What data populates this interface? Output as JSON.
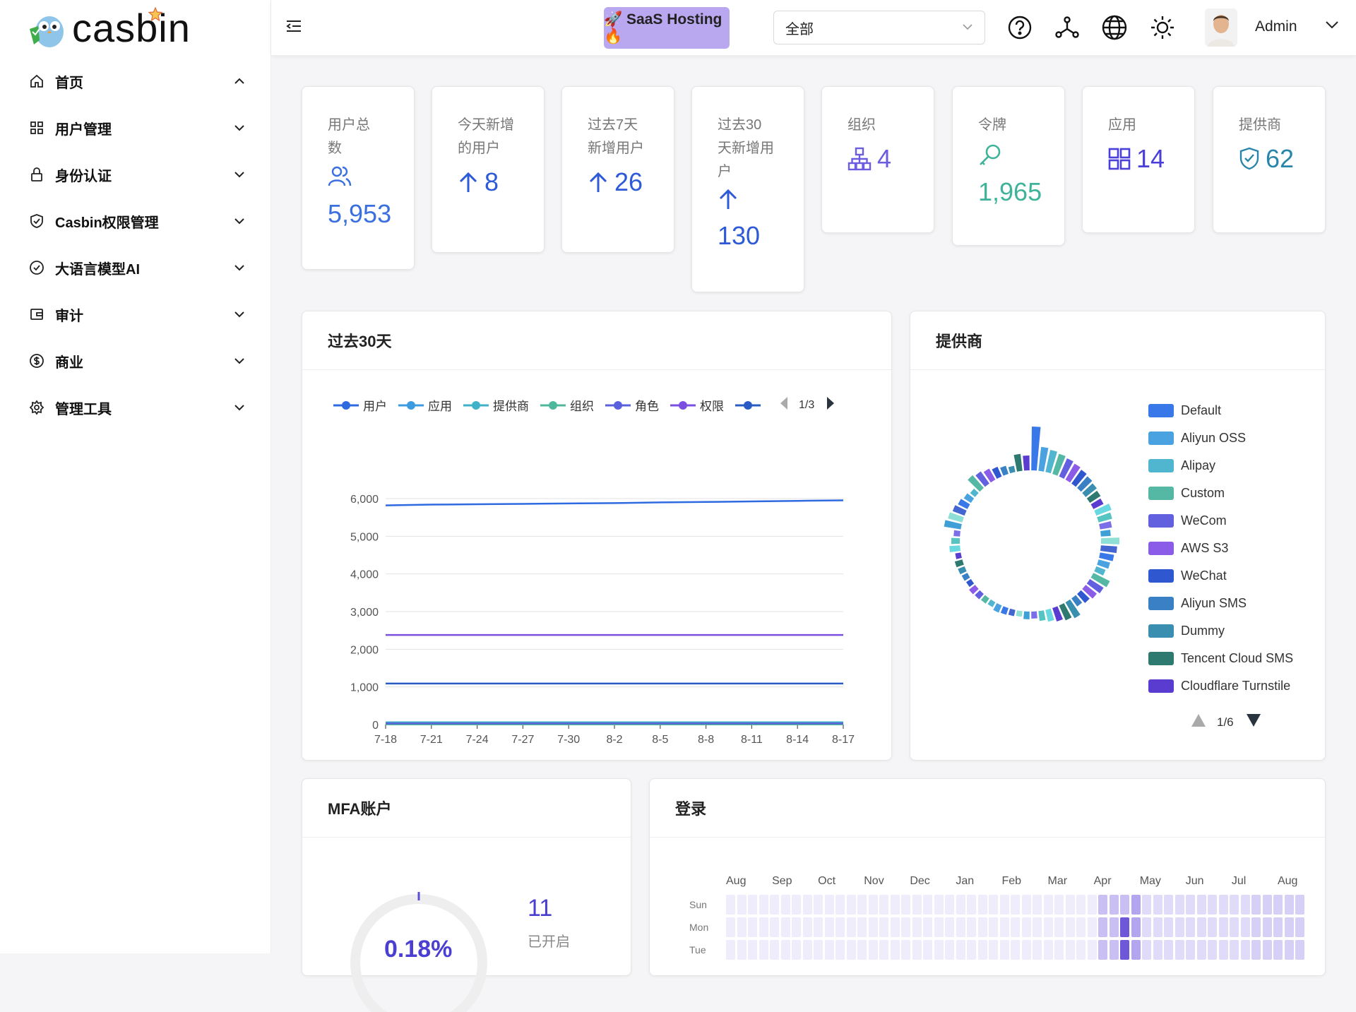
{
  "app": {
    "name": "casbin"
  },
  "sidebar": {
    "items": [
      {
        "label": "首页",
        "icon": "home-icon",
        "expanded": true
      },
      {
        "label": "用户管理",
        "icon": "grid-icon",
        "expanded": false
      },
      {
        "label": "身份认证",
        "icon": "lock-icon",
        "expanded": false
      },
      {
        "label": "Casbin权限管理",
        "icon": "shield-icon",
        "expanded": false
      },
      {
        "label": "大语言模型AI",
        "icon": "check-circle-icon",
        "expanded": false
      },
      {
        "label": "审计",
        "icon": "wallet-icon",
        "expanded": false
      },
      {
        "label": "商业",
        "icon": "dollar-icon",
        "expanded": false
      },
      {
        "label": "管理工具",
        "icon": "gear-icon",
        "expanded": false
      }
    ]
  },
  "header": {
    "saas_label": "🚀 SaaS Hosting 🔥",
    "org_select_value": "全部",
    "username": "Admin",
    "icons": [
      "help-icon",
      "graph-icon",
      "globe-icon",
      "sun-icon"
    ]
  },
  "stats": [
    {
      "title": "用户总数",
      "value": "5,953",
      "icon": "users-icon",
      "color": "#3a6fe0"
    },
    {
      "title": "今天新增的用户",
      "value": "8",
      "icon": "arrow-up-icon",
      "color": "#2e5ad8"
    },
    {
      "title": "过去7天新增用户",
      "value": "26",
      "icon": "arrow-up-icon",
      "color": "#2e5ad8"
    },
    {
      "title": "过去30天新增用户",
      "value": "130",
      "icon": "arrow-up-icon",
      "color": "#2e5ad8"
    },
    {
      "title": "组织",
      "value": "4",
      "icon": "org-icon",
      "color": "#6b5ce0"
    },
    {
      "title": "令牌",
      "value": "1,965",
      "icon": "key-icon",
      "color": "#3fb39a"
    },
    {
      "title": "应用",
      "value": "14",
      "icon": "apps-icon",
      "color": "#4a3fd8"
    },
    {
      "title": "提供商",
      "value": "62",
      "icon": "shield-check-icon",
      "color": "#2a86a8"
    }
  ],
  "trend_panel": {
    "title": "过去30天",
    "legend": [
      "用户",
      "应用",
      "提供商",
      "组织",
      "角色",
      "权限"
    ],
    "legend_page": "1/3"
  },
  "chart_data": {
    "type": "line",
    "x": [
      "7-18",
      "7-21",
      "7-24",
      "7-27",
      "7-30",
      "8-2",
      "8-5",
      "8-8",
      "8-11",
      "8-14",
      "8-17"
    ],
    "ylim": [
      0,
      6000
    ],
    "yticks": [
      "0",
      "1,000",
      "2,000",
      "3,000",
      "4,000",
      "5,000",
      "6,000"
    ],
    "series": [
      {
        "name": "用户",
        "color": "#2e6ae0",
        "values": [
          5820,
          5840,
          5850,
          5860,
          5870,
          5880,
          5900,
          5910,
          5925,
          5940,
          5953
        ]
      },
      {
        "name": "应用",
        "color": "#3d9be0",
        "values": [
          14,
          14,
          14,
          14,
          14,
          14,
          14,
          14,
          14,
          14,
          14
        ]
      },
      {
        "name": "提供商",
        "color": "#3fb2c8",
        "values": [
          62,
          62,
          62,
          62,
          62,
          62,
          62,
          62,
          62,
          62,
          62
        ]
      },
      {
        "name": "组织",
        "color": "#4fb89c",
        "values": [
          4,
          4,
          4,
          4,
          4,
          4,
          4,
          4,
          4,
          4,
          4
        ]
      },
      {
        "name": "角色",
        "color": "#5a5fdc",
        "values": [
          30,
          30,
          30,
          30,
          30,
          30,
          30,
          30,
          30,
          30,
          30
        ]
      },
      {
        "name": "权限",
        "color": "#7b4fe0",
        "values": [
          2380,
          2380,
          2380,
          2380,
          2380,
          2380,
          2380,
          2380,
          2380,
          2380,
          2380
        ]
      },
      {
        "color": "#2a5bc4",
        "values": [
          1090,
          1090,
          1090,
          1090,
          1090,
          1090,
          1090,
          1090,
          1090,
          1090,
          1090
        ]
      }
    ]
  },
  "provider_panel": {
    "title": "提供商",
    "legend": [
      {
        "label": "Default",
        "color": "#3878e8"
      },
      {
        "label": "Aliyun OSS",
        "color": "#4aa3e0"
      },
      {
        "label": "Alipay",
        "color": "#50b6d0"
      },
      {
        "label": "Custom",
        "color": "#55b8a4"
      },
      {
        "label": "WeCom",
        "color": "#6360e0"
      },
      {
        "label": "AWS S3",
        "color": "#8b5ce8"
      },
      {
        "label": "WeChat",
        "color": "#2f58d0"
      },
      {
        "label": "Aliyun SMS",
        "color": "#3a80c4"
      },
      {
        "label": "Dummy",
        "color": "#3a8fb0"
      },
      {
        "label": "Tencent Cloud SMS",
        "color": "#2f7a70"
      },
      {
        "label": "Cloudflare Turnstile",
        "color": "#5a3cd0"
      }
    ],
    "page": "1/6"
  },
  "mfa_panel": {
    "title": "MFA账户",
    "percent": "0.18%",
    "count": "11",
    "count_label": "已开启"
  },
  "login_panel": {
    "title": "登录",
    "months": [
      "Aug",
      "Sep",
      "Oct",
      "Nov",
      "Dec",
      "Jan",
      "Feb",
      "Mar",
      "Apr",
      "May",
      "Jun",
      "Jul",
      "Aug"
    ],
    "days": [
      "Sun",
      "Mon",
      "Tue"
    ]
  }
}
